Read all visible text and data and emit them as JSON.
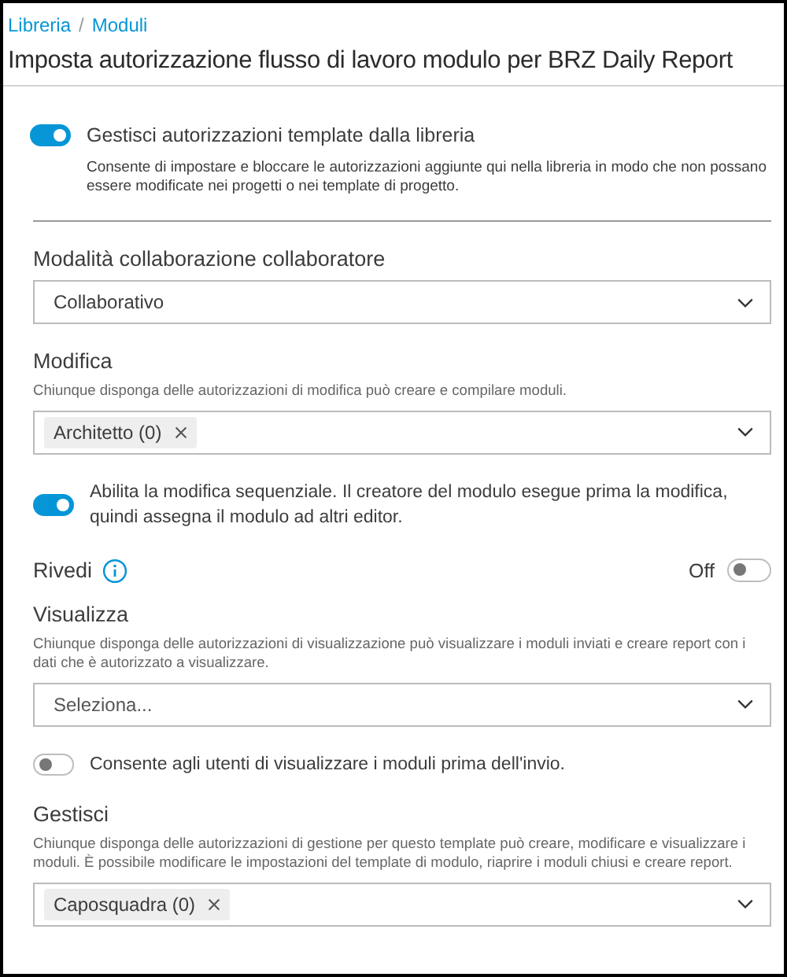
{
  "breadcrumb": {
    "items": [
      "Libreria",
      "Moduli"
    ],
    "separator": "/"
  },
  "title": "Imposta autorizzazione flusso di lavoro modulo per BRZ Daily Report",
  "library_toggle": {
    "on": true,
    "label": "Gestisci autorizzazioni template dalla libreria",
    "description": "Consente di impostare e bloccare le autorizzazioni aggiunte qui nella libreria in modo che non possano essere modificate nei progetti o nei template di progetto."
  },
  "sections": [
    {
      "kind": "select",
      "label": "Modalità collaborazione collaboratore",
      "value": "Collaborativo"
    },
    {
      "kind": "select",
      "label": "Modifica",
      "hint": "Chiunque disponga delle autorizzazioni di modifica può creare e compilare moduli.",
      "chips": [
        "Architetto (0)"
      ]
    },
    {
      "kind": "toggle",
      "on": true,
      "label": "Abilita la modifica sequenziale. Il creatore del modulo esegue prima la modifica, quindi assegna il modulo ad altri editor."
    },
    {
      "kind": "switch-header",
      "label": "Rivedi",
      "state_text": "Off",
      "on": false
    },
    {
      "kind": "select",
      "label": "Visualizza",
      "hint": "Chiunque disponga delle autorizzazioni di visualizzazione può visualizzare i moduli inviati e creare report con i dati che è autorizzato a visualizzare.",
      "placeholder": "Seleziona..."
    },
    {
      "kind": "toggle",
      "on": false,
      "label": "Consente agli utenti di visualizzare i moduli prima dell'invio."
    },
    {
      "kind": "select",
      "label": "Gestisci",
      "hint": "Chiunque disponga delle autorizzazioni di gestione per questo template può creare, modificare e visualizzare i moduli. È possibile modificare le impostazioni del template di modulo, riaprire i moduli chiusi e creare report.",
      "chips": [
        "Caposquadra (0)"
      ]
    }
  ]
}
